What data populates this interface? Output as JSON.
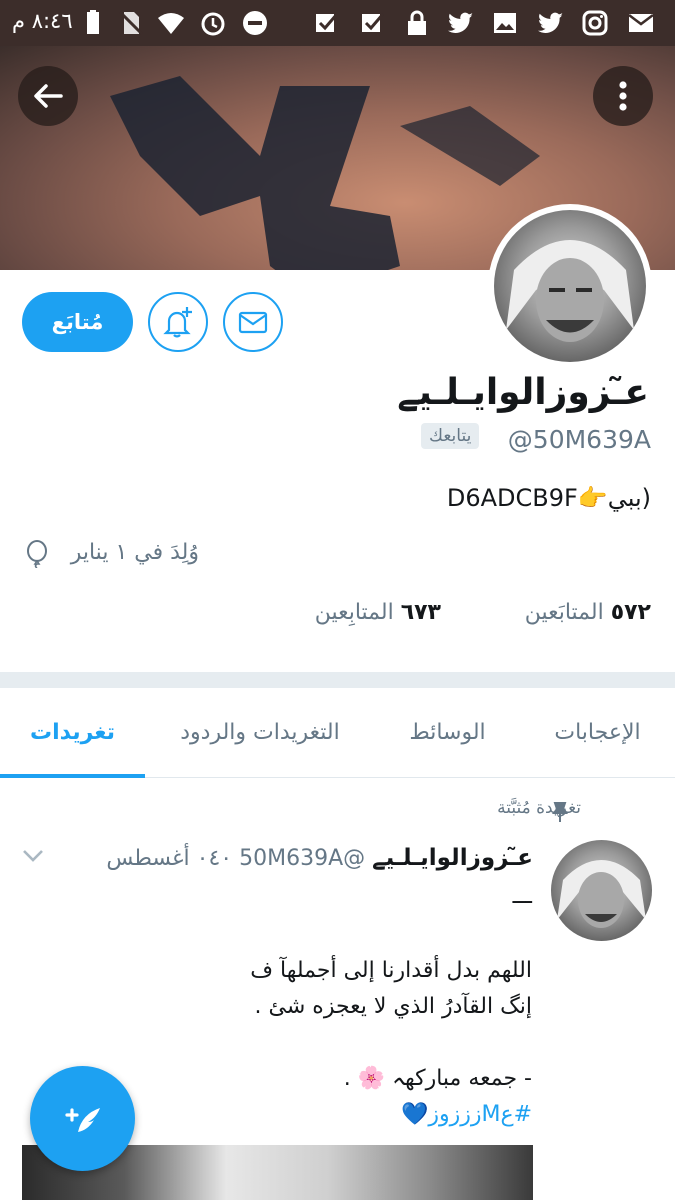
{
  "status_bar": {
    "time": "٨:٤٦ م",
    "icons": [
      "battery-icon",
      "no-sim-icon",
      "wifi-icon",
      "alarm-icon",
      "do-not-disturb-icon",
      "check-box-icon",
      "check-box-icon",
      "lock-icon",
      "twitter-icon",
      "image-icon",
      "twitter-icon",
      "instagram-icon",
      "mail-icon"
    ]
  },
  "header": {
    "back_icon": "arrow-left-icon",
    "more_icon": "more-vertical-icon"
  },
  "profile": {
    "display_name": "ع̃ـزوزالوايـلـيے",
    "handle": "@50M639A",
    "follows_you": "يتابعك",
    "bio_prefix": "(ببي",
    "bio_emoji": "👉",
    "bio_suffix": "D6ADCB9F",
    "birthday": "وُلِدَ في ١ يناير",
    "following_count": "٥٧٢",
    "following_label": "المتابَعين",
    "followers_count": "٦٧٣",
    "followers_label": "المتابِعين"
  },
  "actions": {
    "follow_label": "مُتابَع",
    "notify_icon": "bell-plus-icon",
    "message_icon": "mail-icon"
  },
  "tabs": [
    {
      "label": "تغريدات",
      "active": true
    },
    {
      "label": "التغريدات والردود",
      "active": false
    },
    {
      "label": "الوسائط",
      "active": false
    },
    {
      "label": "الإعجابات",
      "active": false
    }
  ],
  "tweet": {
    "pinned_label": "تغريدة مُثبَّتة",
    "author_name": "ع̃ـزوزالوايـلـيے",
    "author_handle": "@50M639A",
    "date": "٠٤٠ أغسطس",
    "dash": "ـــ",
    "lines": [
      "اللهم بدل أقدارنا إلى أجملهآ ف",
      "إنگ القآدرُ الذي لا يعجزه شئ .",
      "",
      "- جمعه مباركهہ 🌸 .",
      "#عMزززوز💙"
    ]
  },
  "fab": {
    "icon": "compose-tweet-icon"
  },
  "colors": {
    "accent": "#1da1f2",
    "status_bar": "#3c2d2a",
    "muted": "#657786"
  }
}
